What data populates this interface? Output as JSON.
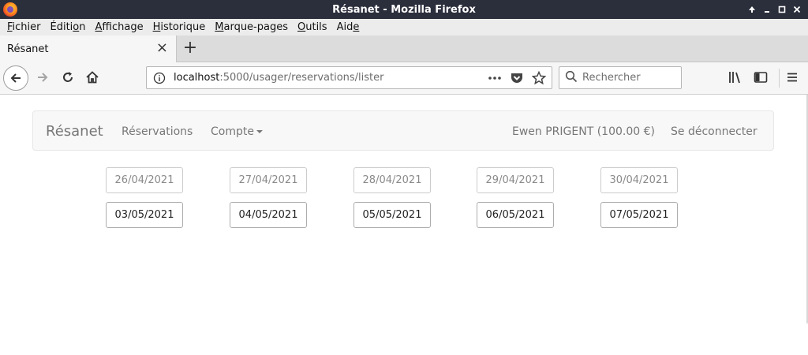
{
  "window": {
    "title": "Résanet - Mozilla Firefox"
  },
  "menu": [
    {
      "pre": "",
      "ul": "F",
      "post": "ichier"
    },
    {
      "pre": "Éditi",
      "ul": "o",
      "post": "n"
    },
    {
      "pre": "",
      "ul": "A",
      "post": "ffichage"
    },
    {
      "pre": "",
      "ul": "H",
      "post": "istorique"
    },
    {
      "pre": "",
      "ul": "M",
      "post": "arque-pages"
    },
    {
      "pre": "",
      "ul": "O",
      "post": "utils"
    },
    {
      "pre": "Aid",
      "ul": "e",
      "post": ""
    }
  ],
  "tab": {
    "title": "Résanet"
  },
  "urlbar": {
    "host": "localhost",
    "rest": ":5000/usager/reservations/lister"
  },
  "search": {
    "placeholder": "Rechercher"
  },
  "appnav": {
    "brand": "Résanet",
    "reservations": "Réservations",
    "account": "Compte",
    "user": "Ewen PRIGENT (100.00 €)",
    "logout": "Se déconnecter"
  },
  "weeks": [
    {
      "state": "past",
      "days": [
        "26/04/2021",
        "27/04/2021",
        "28/04/2021",
        "29/04/2021",
        "30/04/2021"
      ]
    },
    {
      "state": "future",
      "days": [
        "03/05/2021",
        "04/05/2021",
        "05/05/2021",
        "06/05/2021",
        "07/05/2021"
      ]
    }
  ]
}
